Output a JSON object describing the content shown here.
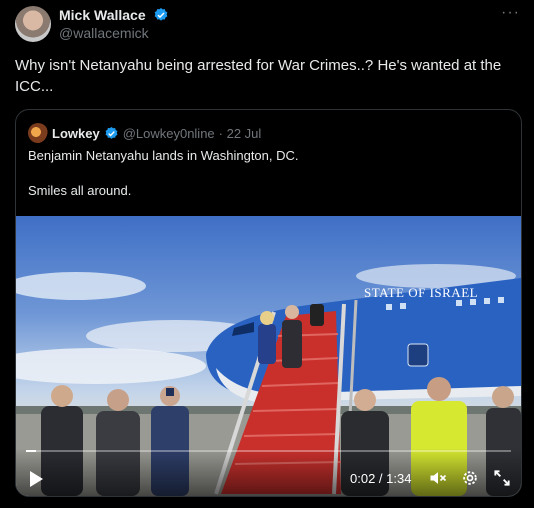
{
  "author": {
    "name": "Mick Wallace",
    "handle": "@wallacemick"
  },
  "menu_glyph": "···",
  "tweet_text": "Why isn't Netanyahu being arrested for War Crimes..? He's wanted at the ICC...",
  "quote": {
    "name": "Lowkey",
    "handle": "@Lowkey0nline",
    "date": "· 22 Jul",
    "text_line1": "Benjamin Netanyahu lands in Washington, DC.",
    "text_line2": "Smiles all around."
  },
  "video": {
    "plane_livery": "STATE OF ISRAEL",
    "time": "0:02 / 1:34",
    "progress_fraction": 0.021
  },
  "colors": {
    "bg": "#000000",
    "text": "#e7e9ea",
    "muted": "#71767b",
    "verified": "#1d9bf0",
    "border": "#2f3336"
  }
}
